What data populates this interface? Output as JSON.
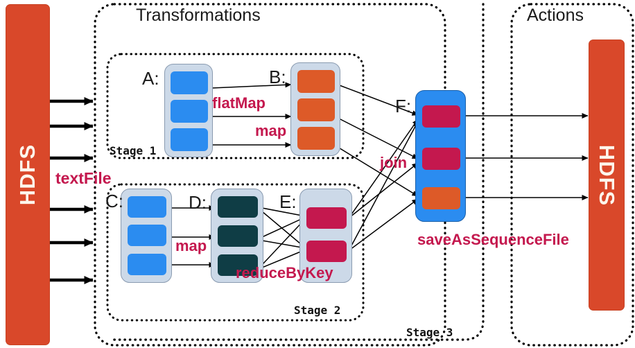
{
  "diagram": {
    "title_transformations": "Transformations",
    "title_actions": "Actions",
    "storage_left": "HDFS",
    "storage_right": "HDFS",
    "stages": {
      "stage1": "Stage 1",
      "stage2": "Stage 2",
      "stage3": "Stage 3"
    },
    "rdd_labels": {
      "a": "A:",
      "b": "B:",
      "c": "C:",
      "d": "D:",
      "e": "E:",
      "f": "F:"
    },
    "operations": {
      "text_file": "textFile",
      "flat_map": "flatMap",
      "map_top": "map",
      "map_bottom": "map",
      "reduce_by_key": "reduceByKey",
      "join": "join",
      "save_as_sequence_file": "saveAsSequenceFile"
    },
    "colors": {
      "hdfs": "#d9482a",
      "rdd_container": "#ccd9e8",
      "partition_blue": "#2b8cf0",
      "partition_orange": "#dd5a28",
      "partition_teal": "#0f3d45",
      "partition_crimson": "#c4184e",
      "operation_text": "#c4184e",
      "arrow": "#000000",
      "boundary": "#000000"
    }
  }
}
